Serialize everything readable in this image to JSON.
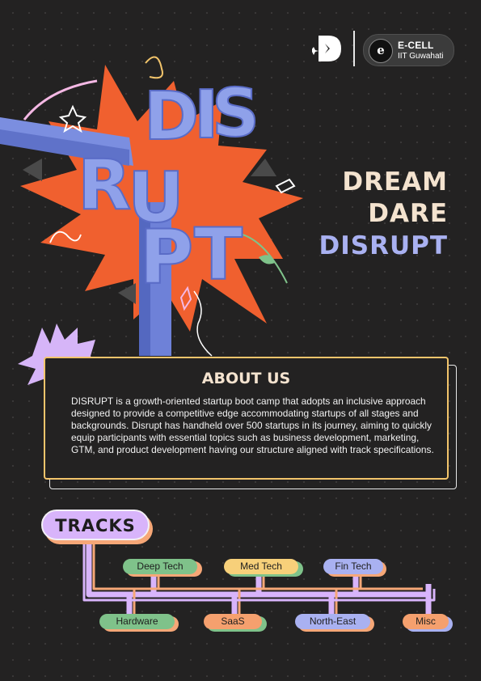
{
  "header": {
    "logo_alt": "Disrupt logo",
    "org_name": "E-CELL",
    "org_sub": "IIT Guwahati",
    "org_badge": "e"
  },
  "hero": {
    "letters": [
      "D",
      "I",
      "S",
      "R",
      "U",
      "P",
      "T"
    ]
  },
  "slogan": {
    "line1": "DREAM",
    "line2": "DARE",
    "line3": "DISRUPT"
  },
  "about": {
    "title": "ABOUT US",
    "body": "DISRUPT is a growth-oriented startup boot camp that adopts an inclusive approach designed to provide a competitive edge accommodating startups of all stages and backgrounds. Disrupt has handheld over 500 startups in its journey, aiming to quickly equip participants with essential topics such as business development, marketing, GTM, and product development having our structure aligned with track specifications."
  },
  "tracks": {
    "title": "TRACKS",
    "items": [
      {
        "label": "Deep Tech",
        "color": "#7fc28a"
      },
      {
        "label": "Med Tech",
        "color": "#f7d07a"
      },
      {
        "label": "Fin Tech",
        "color": "#a9b1f1"
      },
      {
        "label": "Hardware",
        "color": "#7fc28a"
      },
      {
        "label": "SaaS",
        "color": "#f5a06e"
      },
      {
        "label": "North-East",
        "color": "#a9b1f1"
      },
      {
        "label": "Misc",
        "color": "#f5a06e"
      }
    ]
  },
  "colors": {
    "background": "#232222",
    "cream": "#f4e3cf",
    "lavender": "#a9b1f1",
    "orange": "#f0602f",
    "gold": "#f2c46b",
    "purple": "#d8b4fb"
  }
}
